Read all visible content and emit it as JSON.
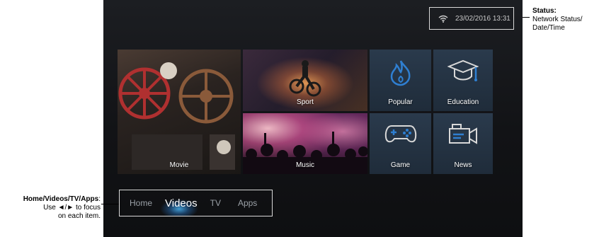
{
  "status": {
    "datetime": "23/02/2016 13:31",
    "wifi_icon": "wifi-icon"
  },
  "tiles": {
    "movie": "Movie",
    "sport": "Sport",
    "music": "Music",
    "popular": "Popular",
    "education": "Education",
    "game": "Game",
    "news": "News"
  },
  "nav": {
    "home": "Home",
    "videos": "Videos",
    "tv": "TV",
    "apps": "Apps",
    "active": "Videos"
  },
  "callouts": {
    "status_title": "Status:",
    "status_line1": "Network Status/",
    "status_line2": "Date/Time",
    "nav_title": "Home/Videos/TV/Apps",
    "nav_line1": "Use ◄/► to focus",
    "nav_line2": "on each item."
  },
  "colors": {
    "tile_icon": "#2f7fd1",
    "focus_glow": "#46aae6"
  }
}
